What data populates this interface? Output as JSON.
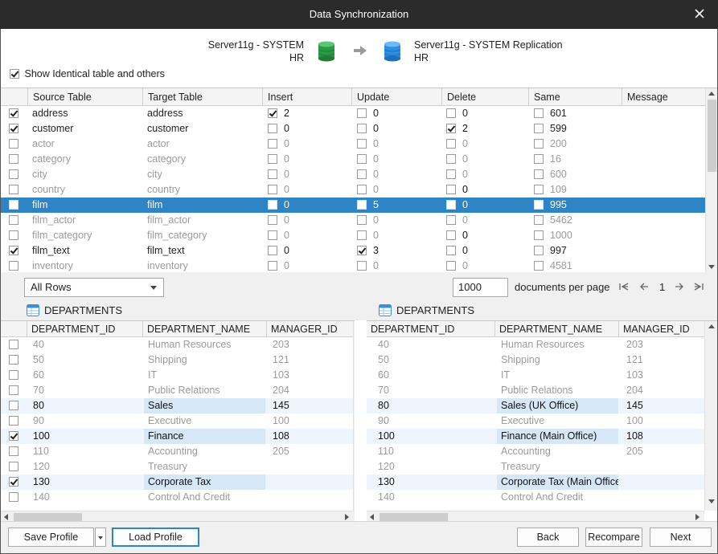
{
  "window": {
    "title": "Data Synchronization"
  },
  "source": {
    "server": "Server11g - SYSTEM",
    "schema": "HR"
  },
  "target": {
    "server": "Server11g - SYSTEM Replication",
    "schema": "HR"
  },
  "colors": {
    "selection": "#2f84c6",
    "db_source": "#2a9a45",
    "db_target": "#2c8ee0",
    "highlight_cell": "#d6e8f8"
  },
  "show_identical": {
    "label": "Show Identical table and others",
    "checked": true
  },
  "top_grid": {
    "headers": [
      "Source Table",
      "Target Table",
      "Insert",
      "Update",
      "Delete",
      "Same",
      "Message"
    ],
    "rows": [
      {
        "checked": true,
        "source": "address",
        "target": "address",
        "insert": "2",
        "insert_checked": true,
        "update": "0",
        "update_checked": false,
        "delete": "0",
        "delete_checked": false,
        "same": "601",
        "dim": false,
        "selected": false
      },
      {
        "checked": true,
        "source": "customer",
        "target": "customer",
        "insert": "0",
        "insert_checked": false,
        "update": "0",
        "update_checked": false,
        "delete": "2",
        "delete_checked": true,
        "same": "599",
        "dim": false,
        "selected": false
      },
      {
        "checked": false,
        "source": "actor",
        "target": "actor",
        "insert": "0",
        "insert_checked": false,
        "update": "0",
        "update_checked": false,
        "delete": "0",
        "delete_checked": false,
        "same": "200",
        "dim": true,
        "selected": false
      },
      {
        "checked": false,
        "source": "category",
        "target": "category",
        "insert": "0",
        "insert_checked": false,
        "update": "0",
        "update_checked": false,
        "delete": "0",
        "delete_checked": false,
        "same": "16",
        "dim": true,
        "selected": false
      },
      {
        "checked": false,
        "source": "city",
        "target": "city",
        "insert": "0",
        "insert_checked": false,
        "update": "0",
        "update_checked": false,
        "delete": "0",
        "delete_checked": false,
        "same": "600",
        "dim": true,
        "selected": false
      },
      {
        "checked": false,
        "source": "country",
        "target": "country",
        "insert": "0",
        "insert_checked": false,
        "update": "0",
        "update_checked": false,
        "delete": "0",
        "delete_checked": false,
        "same": "109",
        "dim": true,
        "selected": false
      },
      {
        "checked": true,
        "source": "film",
        "target": "film",
        "insert": "0",
        "insert_checked": false,
        "update": "5",
        "update_checked": true,
        "delete": "0",
        "delete_checked": false,
        "same": "995",
        "dim": false,
        "selected": true
      },
      {
        "checked": false,
        "source": "film_actor",
        "target": "film_actor",
        "insert": "0",
        "insert_checked": false,
        "update": "0",
        "update_checked": false,
        "delete": "0",
        "delete_checked": false,
        "same": "5462",
        "dim": true,
        "selected": false
      },
      {
        "checked": false,
        "source": "film_category",
        "target": "film_category",
        "insert": "0",
        "insert_checked": false,
        "update": "0",
        "update_checked": false,
        "delete": "0",
        "delete_checked": false,
        "same": "1000",
        "dim": true,
        "selected": false
      },
      {
        "checked": true,
        "source": "film_text",
        "target": "film_text",
        "insert": "0",
        "insert_checked": false,
        "update": "3",
        "update_checked": true,
        "delete": "0",
        "delete_checked": false,
        "same": "997",
        "dim": false,
        "selected": false
      },
      {
        "checked": false,
        "source": "inventory",
        "target": "inventory",
        "insert": "0",
        "insert_checked": false,
        "update": "0",
        "update_checked": false,
        "delete": "0",
        "delete_checked": false,
        "same": "4581",
        "dim": true,
        "selected": false
      }
    ]
  },
  "filter": {
    "selected": "All Rows"
  },
  "paging": {
    "page_size": "1000",
    "label": "documents per page",
    "page": "1"
  },
  "left_panel": {
    "title": "DEPARTMENTS",
    "headers": [
      "DEPARTMENT_ID",
      "DEPARTMENT_NAME",
      "MANAGER_ID"
    ],
    "rows": [
      {
        "checked": false,
        "id": "40",
        "name": "Human Resources",
        "manager": "203",
        "diff": false
      },
      {
        "checked": false,
        "id": "50",
        "name": "Shipping",
        "manager": "121",
        "diff": false
      },
      {
        "checked": false,
        "id": "60",
        "name": "IT",
        "manager": "103",
        "diff": false
      },
      {
        "checked": false,
        "id": "70",
        "name": "Public Relations",
        "manager": "204",
        "diff": false
      },
      {
        "checked": false,
        "id": "80",
        "name": "Sales",
        "manager": "145",
        "diff": true
      },
      {
        "checked": false,
        "id": "90",
        "name": "Executive",
        "manager": "100",
        "diff": false
      },
      {
        "checked": true,
        "id": "100",
        "name": "Finance",
        "manager": "108",
        "diff": true
      },
      {
        "checked": false,
        "id": "110",
        "name": "Accounting",
        "manager": "205",
        "diff": false
      },
      {
        "checked": false,
        "id": "120",
        "name": "Treasury",
        "manager": "",
        "diff": false
      },
      {
        "checked": true,
        "id": "130",
        "name": "Corporate Tax",
        "manager": "",
        "diff": true
      },
      {
        "checked": false,
        "id": "140",
        "name": "Control And Credit",
        "manager": "",
        "diff": false
      }
    ]
  },
  "right_panel": {
    "title": "DEPARTMENTS",
    "headers": [
      "DEPARTMENT_ID",
      "DEPARTMENT_NAME",
      "MANAGER_ID"
    ],
    "rows": [
      {
        "id": "40",
        "name": "Human Resources",
        "manager": "203",
        "diff": false
      },
      {
        "id": "50",
        "name": "Shipping",
        "manager": "121",
        "diff": false
      },
      {
        "id": "60",
        "name": "IT",
        "manager": "103",
        "diff": false
      },
      {
        "id": "70",
        "name": "Public Relations",
        "manager": "204",
        "diff": false
      },
      {
        "id": "80",
        "name": "Sales (UK Office)",
        "manager": "145",
        "diff": true
      },
      {
        "id": "90",
        "name": "Executive",
        "manager": "100",
        "diff": false
      },
      {
        "id": "100",
        "name": "Finance (Main Office)",
        "manager": "108",
        "diff": true
      },
      {
        "id": "110",
        "name": "Accounting",
        "manager": "205",
        "diff": false
      },
      {
        "id": "120",
        "name": "Treasury",
        "manager": "",
        "diff": false
      },
      {
        "id": "130",
        "name": "Corporate Tax (Main Office)",
        "manager": "",
        "diff": true
      },
      {
        "id": "140",
        "name": "Control And Credit",
        "manager": "",
        "diff": false
      }
    ]
  },
  "footer": {
    "save_profile": "Save Profile",
    "load_profile": "Load Profile",
    "back": "Back",
    "recompare": "Recompare",
    "next": "Next"
  }
}
